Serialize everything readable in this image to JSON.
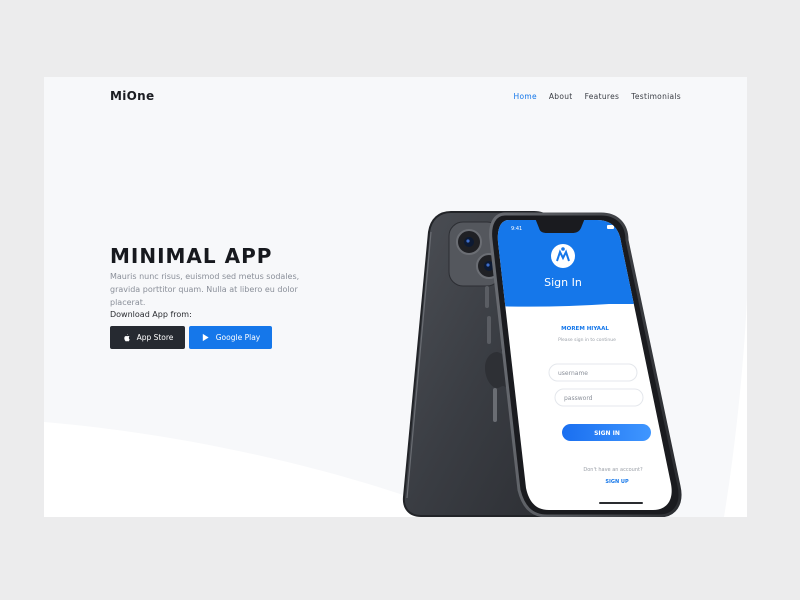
{
  "brand": {
    "logo": "MiOne"
  },
  "nav": [
    {
      "label": "Home",
      "active": true
    },
    {
      "label": "About",
      "active": false
    },
    {
      "label": "Features",
      "active": false
    },
    {
      "label": "Testimonials",
      "active": false
    }
  ],
  "hero": {
    "title": "MINIMAL APP",
    "description": "Mauris nunc risus, euismod sed metus sodales, gravida porttitor quam. Nulla at libero eu dolor placerat.",
    "download_label": "Download App from:",
    "buttons": {
      "appstore": {
        "label": "App Store",
        "icon": "apple-icon"
      },
      "play": {
        "label": "Google Play",
        "icon": "play-icon"
      }
    }
  },
  "phone": {
    "time": "9:41",
    "signin_title": "Sign In",
    "username_name": "MOREM HIYAAL",
    "subtitle": "Please sign in to continue",
    "username_placeholder": "username",
    "password_placeholder": "password",
    "signin_button": "SIGN IN",
    "no_account": "Don't have an account?",
    "signup_link": "SIGN UP"
  },
  "colors": {
    "accent": "#1577ea",
    "dark_button": "#262a31",
    "page_bg": "#f7f8fa",
    "frame_bg": "#ececed"
  }
}
